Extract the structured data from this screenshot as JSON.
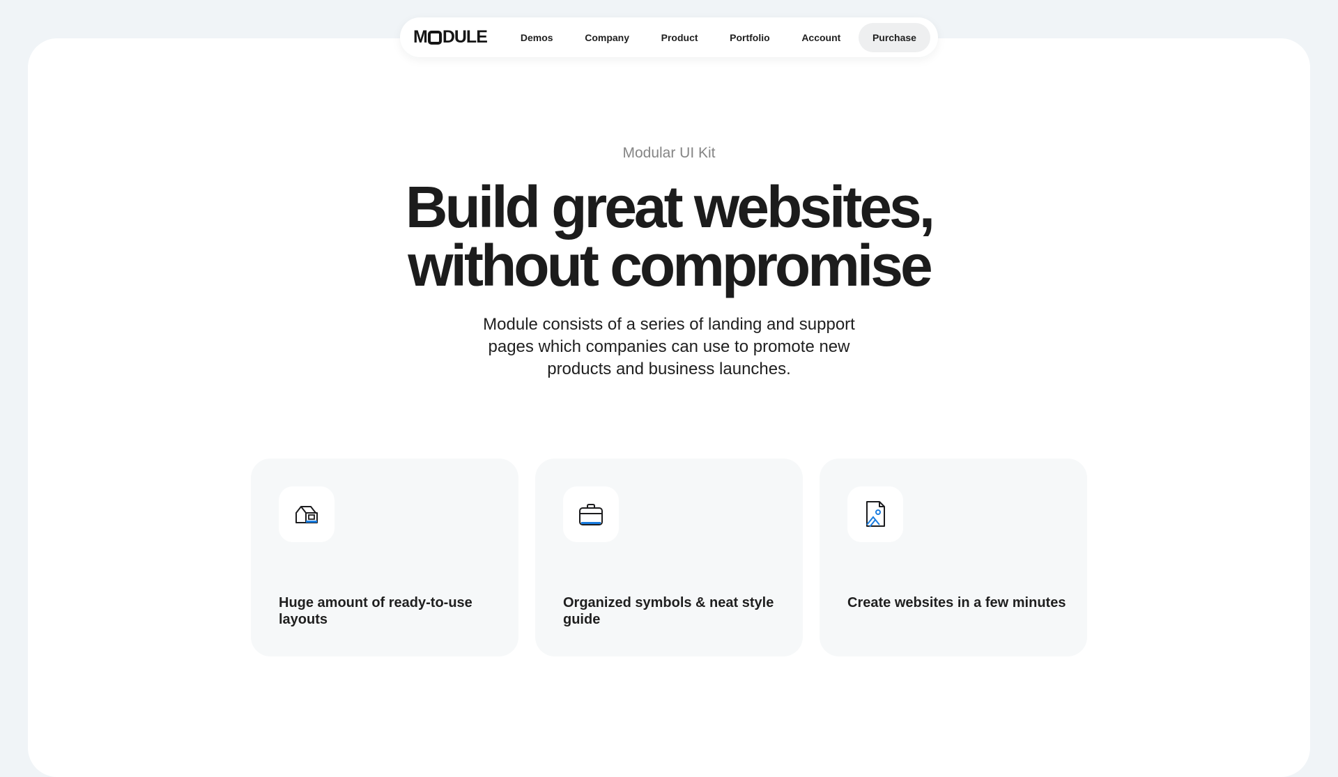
{
  "nav": {
    "logo": {
      "prefix": "M",
      "suffix": "DULE"
    },
    "links": [
      {
        "label": "Demos"
      },
      {
        "label": "Company"
      },
      {
        "label": "Product"
      },
      {
        "label": "Portfolio"
      },
      {
        "label": "Account"
      }
    ],
    "purchase_label": "Purchase"
  },
  "hero": {
    "eyebrow": "Modular UI Kit",
    "headline_line1": "Build great websites,",
    "headline_line2": "without compromise",
    "subtitle": "Module consists of a series of landing and support pages which companies can use to promote new products and business launches."
  },
  "features": [
    {
      "icon": "house-icon",
      "title": "Huge amount of ready-to-use layouts"
    },
    {
      "icon": "briefcase-icon",
      "title": "Organized symbols & neat style guide"
    },
    {
      "icon": "image-file-icon",
      "title": "Create websites in a few minutes"
    }
  ],
  "colors": {
    "page_background": "#f0f4f7",
    "card_background": "#f6f8f9",
    "accent_blue": "#1a7de0",
    "text_dark": "#1c1c1e",
    "eyebrow_gray": "#858585"
  }
}
